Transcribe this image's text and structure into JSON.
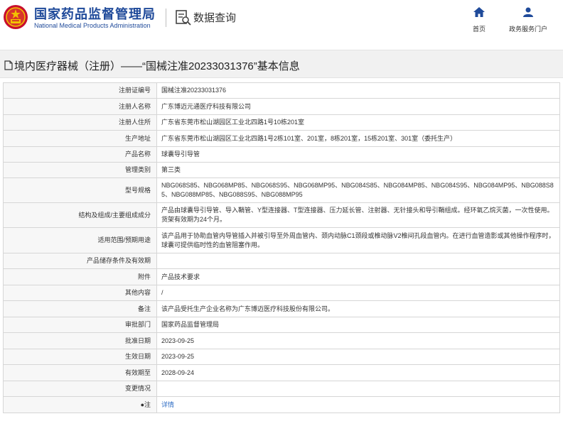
{
  "header": {
    "site_title": "国家药品监督管理局",
    "site_subtitle": "National Medical Products Administration",
    "query_label": "数据查询",
    "nav": [
      {
        "label": "首页",
        "icon": "home-icon"
      },
      {
        "label": "政务服务门户",
        "icon": "user-icon"
      }
    ]
  },
  "title_bar": {
    "title": "境内医疗器械（注册）——“国械注准20233031376”基本信息",
    "icon": "document-icon"
  },
  "details": {
    "rows": [
      {
        "label": "注册证编号",
        "value": "国械注准20233031376"
      },
      {
        "label": "注册人名称",
        "value": "广东博迈元通医疗科技有限公司"
      },
      {
        "label": "注册人住所",
        "value": "广东省东莞市松山湖园区工业北四路1号10栋201室"
      },
      {
        "label": "生产地址",
        "value": "广东省东莞市松山湖园区工业北四路1号2栋101室、201室，8栋201室，15栋201室、301室（委托生产）"
      },
      {
        "label": "产品名称",
        "value": "球囊导引导管"
      },
      {
        "label": "管理类别",
        "value": "第三类"
      },
      {
        "label": "型号规格",
        "value": "NBG068S85、NBG068MP85、NBG068S95、NBG068MP95、NBG084S85、NBG084MP85、NBG084S95、NBG084MP95、NBG088S85、NBG088MP85、NBG088S95、NBG088MP95"
      },
      {
        "label": "结构及组成/主要组成成分",
        "value": "产品由球囊导引导管、导入鞘管、Y型连接器、T型连接器、压力延长管、注射器、无针接头和导引鞘组成。经环氧乙烷灭菌，一次性使用。货架有效期为24个月。"
      },
      {
        "label": "适用范围/预期用途",
        "value": "该产品用于协助血管内导管插入并被引导至外周血管内、颈内动脉C1颈段或椎动脉V2椎间孔段血管内。在进行血管造影或其他操作程序时，球囊可提供临时性的血管阻塞作用。"
      },
      {
        "label": "产品储存条件及有效期",
        "value": ""
      },
      {
        "label": "附件",
        "value": "产品技术要求"
      },
      {
        "label": "其他内容",
        "value": "/"
      },
      {
        "label": "备注",
        "value": "该产品受托生产企业名称为广东博迈医疗科技股份有限公司。"
      },
      {
        "label": "审批部门",
        "value": "国家药品监督管理局"
      },
      {
        "label": "批准日期",
        "value": "2023-09-25"
      },
      {
        "label": "生效日期",
        "value": "2023-09-25"
      },
      {
        "label": "有效期至",
        "value": "2028-09-24"
      },
      {
        "label": "变更情况",
        "value": ""
      },
      {
        "label": "●注",
        "value": "详情"
      }
    ]
  }
}
